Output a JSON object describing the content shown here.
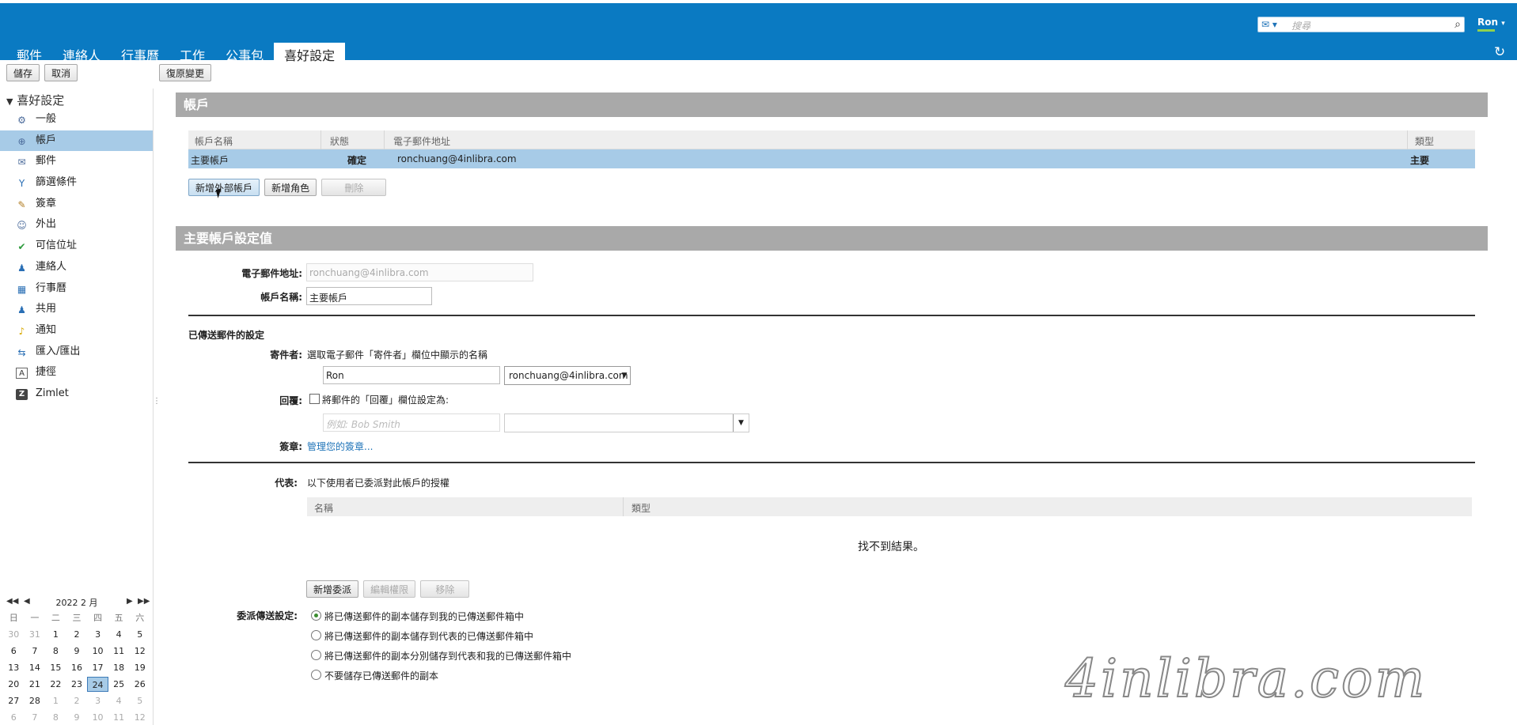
{
  "app": {
    "search_placeholder": "搜尋",
    "user_name": "Ron",
    "tabs": [
      "郵件",
      "連絡人",
      "行事曆",
      "工作",
      "公事包",
      "喜好設定"
    ]
  },
  "toolbar": {
    "save": "儲存",
    "cancel": "取消",
    "revert": "復原變更"
  },
  "sidebar": {
    "root": "喜好設定",
    "items": [
      {
        "label": "一般",
        "icon": "gear-icon"
      },
      {
        "label": "帳戶",
        "icon": "account-icon"
      },
      {
        "label": "郵件",
        "icon": "mail-icon"
      },
      {
        "label": "篩選條件",
        "icon": "filter-icon"
      },
      {
        "label": "簽章",
        "icon": "signature-icon"
      },
      {
        "label": "外出",
        "icon": "out-of-office-icon"
      },
      {
        "label": "可信位址",
        "icon": "trusted-shield-icon"
      },
      {
        "label": "連絡人",
        "icon": "contacts-icon"
      },
      {
        "label": "行事曆",
        "icon": "calendar-icon"
      },
      {
        "label": "共用",
        "icon": "sharing-icon"
      },
      {
        "label": "通知",
        "icon": "bell-icon"
      },
      {
        "label": "匯入/匯出",
        "icon": "import-export-icon"
      },
      {
        "label": "捷徑",
        "icon": "shortcut-icon"
      },
      {
        "label": "Zimlet",
        "icon": "zimlet-icon"
      }
    ]
  },
  "calendar": {
    "title": "2022 2 月",
    "dow": [
      "日",
      "一",
      "二",
      "三",
      "四",
      "五",
      "六"
    ],
    "weeks": [
      [
        "30",
        "31",
        "1",
        "2",
        "3",
        "4",
        "5"
      ],
      [
        "6",
        "7",
        "8",
        "9",
        "10",
        "11",
        "12"
      ],
      [
        "13",
        "14",
        "15",
        "16",
        "17",
        "18",
        "19"
      ],
      [
        "20",
        "21",
        "22",
        "23",
        "24",
        "25",
        "26"
      ],
      [
        "27",
        "28",
        "1",
        "2",
        "3",
        "4",
        "5"
      ],
      [
        "6",
        "7",
        "8",
        "9",
        "10",
        "11",
        "12"
      ]
    ]
  },
  "accounts": {
    "header": "帳戶",
    "columns": [
      "帳戶名稱",
      "狀態",
      "電子郵件地址",
      "類型"
    ],
    "row": {
      "name": "主要帳戶",
      "status": "確定",
      "email": "ronchuang@4inlibra.com",
      "type": "主要"
    },
    "add_external": "新增外部帳戶",
    "add_persona": "新增角色",
    "delete": "刪除"
  },
  "settings": {
    "header": "主要帳戶設定值",
    "email_label": "電子郵件地址:",
    "email_value": "ronchuang@4inlibra.com",
    "account_name_label": "帳戶名稱:",
    "account_name_value": "主要帳戶",
    "sent_settings_title": "已傳送郵件的設定",
    "from_label": "寄件者:",
    "from_desc": "選取電子郵件「寄件者」欄位中顯示的名稱",
    "from_name": "Ron",
    "from_address": "ronchuang@4inlibra.com",
    "reply_label": "回覆:",
    "reply_desc": "將郵件的「回覆」欄位設定為:",
    "reply_placeholder": "例如: Bob Smith",
    "signature_label": "簽章:",
    "signature_link": "管理您的簽章...",
    "delegate_label": "代表:",
    "delegate_desc": "以下使用者已委派對此帳戶的授權",
    "delegate_columns": [
      "名稱",
      "類型"
    ],
    "no_results": "找不到結果。",
    "add_delegate": "新增委派",
    "edit_permissions": "編輯權限",
    "remove": "移除",
    "delegate_send_label": "委派傳送設定:",
    "delegate_options": [
      "將已傳送郵件的副本儲存到我的已傳送郵件箱中",
      "將已傳送郵件的副本儲存到代表的已傳送郵件箱中",
      "將已傳送郵件的副本分別儲存到代表和我的已傳送郵件箱中",
      "不要儲存已傳送郵件的副本"
    ],
    "delegate_selected_index": 0
  },
  "watermark": "4inlibra.com"
}
